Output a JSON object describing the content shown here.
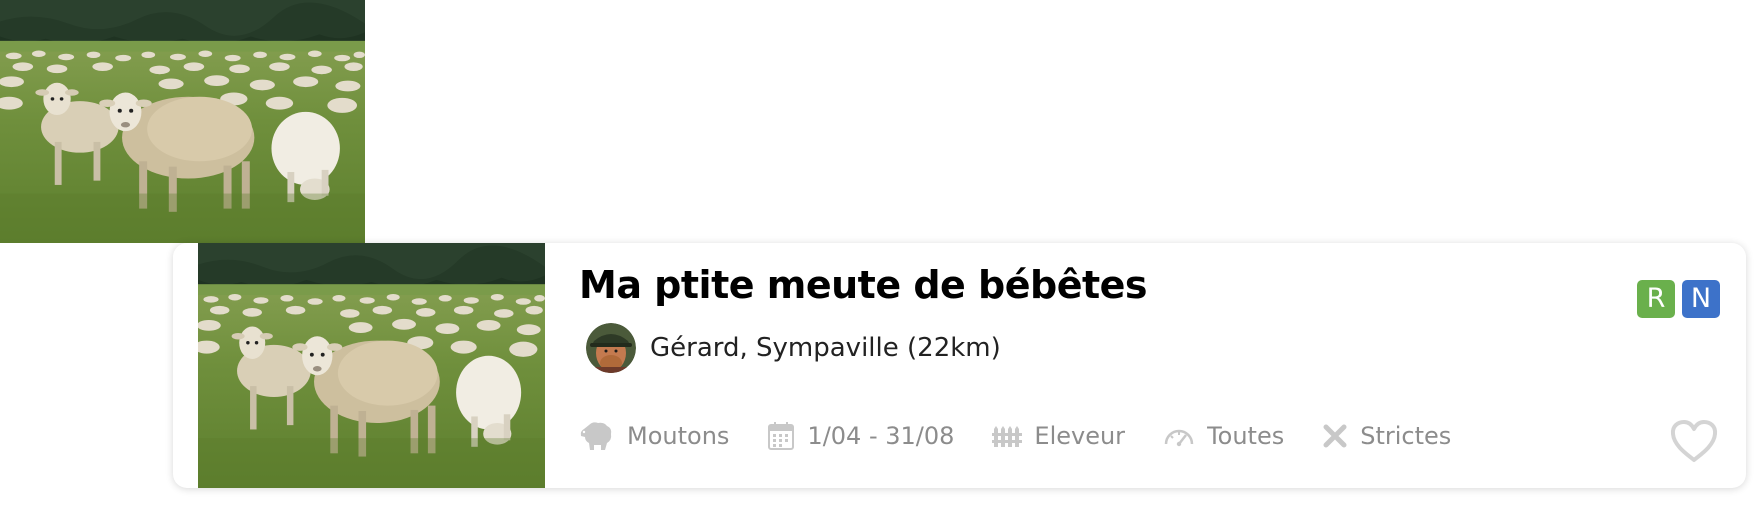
{
  "listing": {
    "title": "Ma ptite meute de bébêtes",
    "photo_icon": "sheep-pasture-photo",
    "owner": {
      "text": "Gérard, Sympaville (22km)",
      "avatar_icon": "user-avatar"
    },
    "badges": [
      {
        "label": "R",
        "color": "#6ab04c"
      },
      {
        "label": "N",
        "color": "#3d72c9"
      }
    ],
    "features": [
      {
        "icon": "sheep-icon",
        "label": "Moutons"
      },
      {
        "icon": "calendar-icon",
        "label": "1/04 - 31/08"
      },
      {
        "icon": "fence-icon",
        "label": "Eleveur"
      },
      {
        "icon": "speedometer-icon",
        "label": "Toutes"
      },
      {
        "icon": "cross-icon",
        "label": "Strictes"
      }
    ],
    "favorite_icon": "heart-icon"
  },
  "colors": {
    "feature_text": "#8c8c8c",
    "icon_gray": "#c8c8c8"
  }
}
